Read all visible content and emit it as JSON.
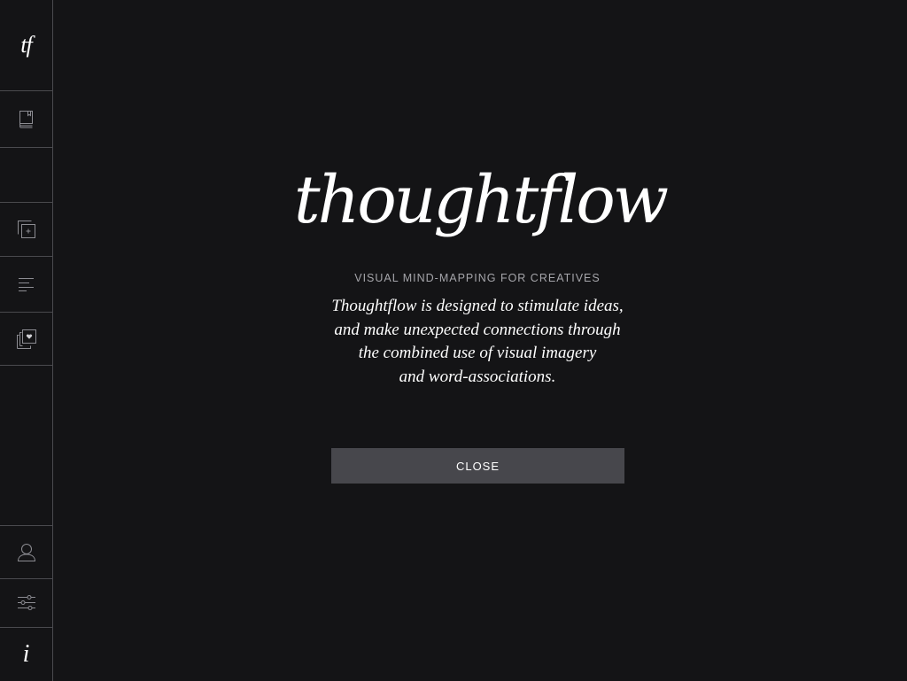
{
  "sidebar": {
    "logo": "tf",
    "items": [
      {
        "name": "notebook",
        "icon": "notebook-icon"
      },
      {
        "name": "empty"
      },
      {
        "name": "add-card",
        "icon": "add-card-icon"
      },
      {
        "name": "list",
        "icon": "list-icon"
      },
      {
        "name": "favorites",
        "icon": "favorites-stack-icon"
      }
    ],
    "bottom": [
      {
        "name": "profile",
        "icon": "user-icon"
      },
      {
        "name": "settings",
        "icon": "sliders-icon"
      },
      {
        "name": "info",
        "icon": "info-icon",
        "label": "i"
      }
    ]
  },
  "about": {
    "title": "thoughtflow",
    "subtitle": "VISUAL MIND-MAPPING FOR CREATIVES",
    "description_lines": [
      "Thoughtflow is designed to stimulate ideas,",
      "and make unexpected connections through",
      "the combined use of visual imagery",
      "and word-associations."
    ],
    "close_label": "CLOSE"
  },
  "colors": {
    "background": "#141416",
    "divider": "#4a4a4e",
    "button": "#47474c",
    "subtitle": "#a5a5aa"
  }
}
